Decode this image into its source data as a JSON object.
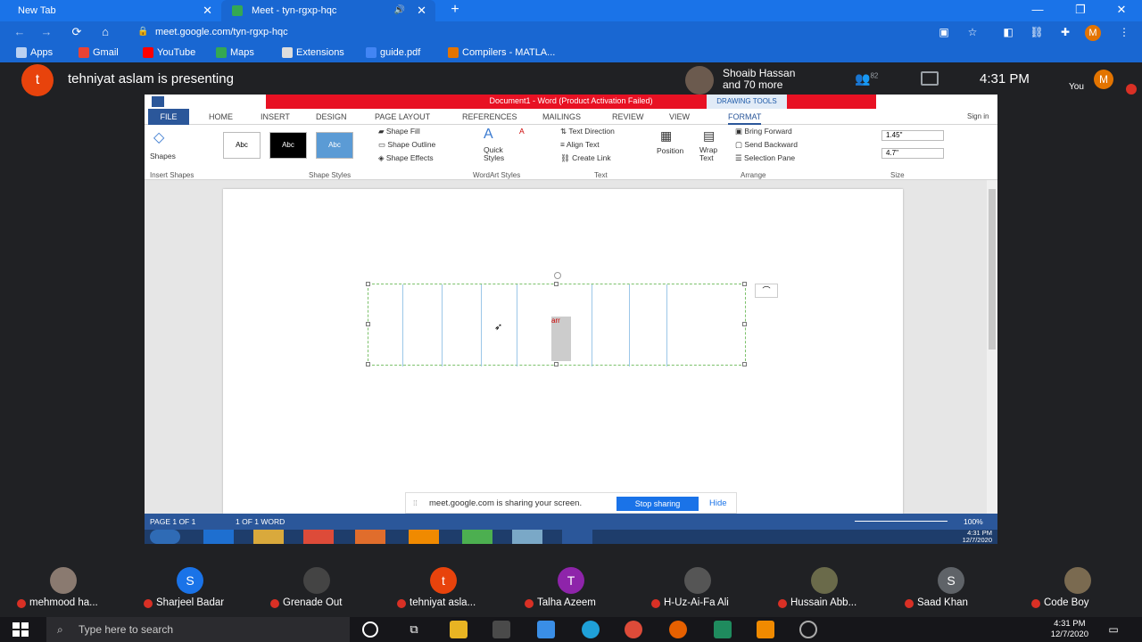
{
  "browser": {
    "tabs": [
      {
        "label": "New Tab"
      },
      {
        "label": "Meet - tyn-rgxp-hqc"
      }
    ],
    "url": "meet.google.com/tyn-rgxp-hqc",
    "bookmarks": [
      "Apps",
      "Gmail",
      "YouTube",
      "Maps",
      "Extensions",
      "guide.pdf",
      "Compilers - MATLA..."
    ],
    "profile_initial": "M"
  },
  "meet": {
    "presenter_initial": "t",
    "presenting_text": "tehniyat aslam is presenting",
    "host_name": "Shoaib Hassan",
    "host_more": "and 70 more",
    "participant_count": "82",
    "time": "4:31 PM",
    "self_label": "You",
    "self_initial": "M",
    "share_notice": "meet.google.com is sharing your screen.",
    "stop_sharing": "Stop sharing",
    "hide": "Hide"
  },
  "word": {
    "title": "Document1 - Word (Product Activation Failed)",
    "drawing_tools": "DRAWING TOOLS",
    "sign_in": "Sign in",
    "tabs": [
      "FILE",
      "HOME",
      "INSERT",
      "DESIGN",
      "PAGE LAYOUT",
      "REFERENCES",
      "MAILINGS",
      "REVIEW",
      "VIEW",
      "FORMAT"
    ],
    "ribbon": {
      "shapes": "Shapes",
      "style_sample": "Abc",
      "shape_fill": "Shape Fill",
      "shape_outline": "Shape Outline",
      "shape_effects": "Shape Effects",
      "quick_styles_1": "Quick",
      "quick_styles_2": "Styles",
      "text_direction": "Text Direction",
      "align_text": "Align Text",
      "create_link": "Create Link",
      "position": "Position",
      "wrap_text_1": "Wrap",
      "wrap_text_2": "Text",
      "bring_forward": "Bring Forward",
      "send_backward": "Send Backward",
      "selection_pane": "Selection Pane",
      "height": "1.45\"",
      "width": "4.7\"",
      "groups": {
        "insert_shapes": "Insert Shapes",
        "shape_styles": "Shape Styles",
        "wordart_styles": "WordArt Styles",
        "text": "Text",
        "arrange": "Arrange",
        "size": "Size"
      }
    },
    "doc_text": "arr",
    "status": {
      "page": "PAGE 1 OF 1",
      "words": "1 OF 1 WORD",
      "zoom": "100%"
    },
    "inner_clock": {
      "time": "4:31 PM",
      "date": "12/7/2020"
    }
  },
  "participants": [
    {
      "name": "mehmood ha...",
      "initial": "",
      "color": "#8a7a70"
    },
    {
      "name": "Sharjeel Badar",
      "initial": "S",
      "color": "#1a73e8"
    },
    {
      "name": "Grenade Out",
      "initial": "",
      "color": "#444"
    },
    {
      "name": "tehniyat asla...",
      "initial": "t",
      "color": "#e8430c"
    },
    {
      "name": "Talha Azeem",
      "initial": "T",
      "color": "#8e24aa"
    },
    {
      "name": "H-Uz-Ai-Fa Ali",
      "initial": "",
      "color": "#555"
    },
    {
      "name": "Hussain Abb...",
      "initial": "",
      "color": "#6a6a4a"
    },
    {
      "name": "Saad Khan",
      "initial": "S",
      "color": "#5f6368"
    },
    {
      "name": "Code Boy",
      "initial": "",
      "color": "#7a6a50"
    }
  ],
  "windows": {
    "search_placeholder": "Type here to search",
    "time": "4:31 PM",
    "date": "12/7/2020"
  }
}
